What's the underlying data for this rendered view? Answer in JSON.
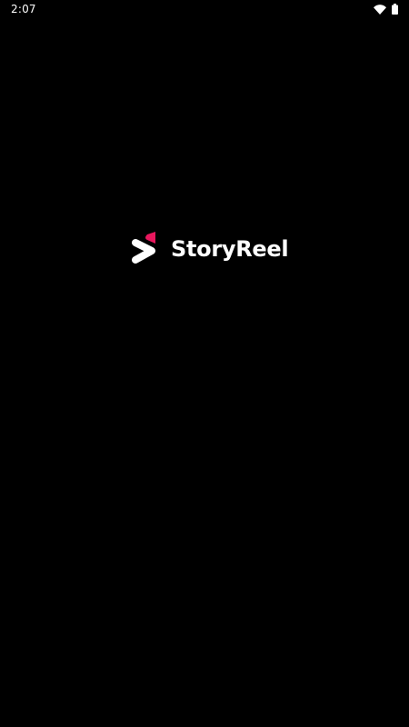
{
  "status_bar": {
    "time": "2:07",
    "icons": [
      "wifi-icon",
      "battery-icon"
    ]
  },
  "splash": {
    "brand_name": "StoryReel",
    "logo_icon": "storyreel-logo-icon"
  },
  "colors": {
    "background": "#000000",
    "text": "#ffffff",
    "accent": "#e8175d"
  }
}
